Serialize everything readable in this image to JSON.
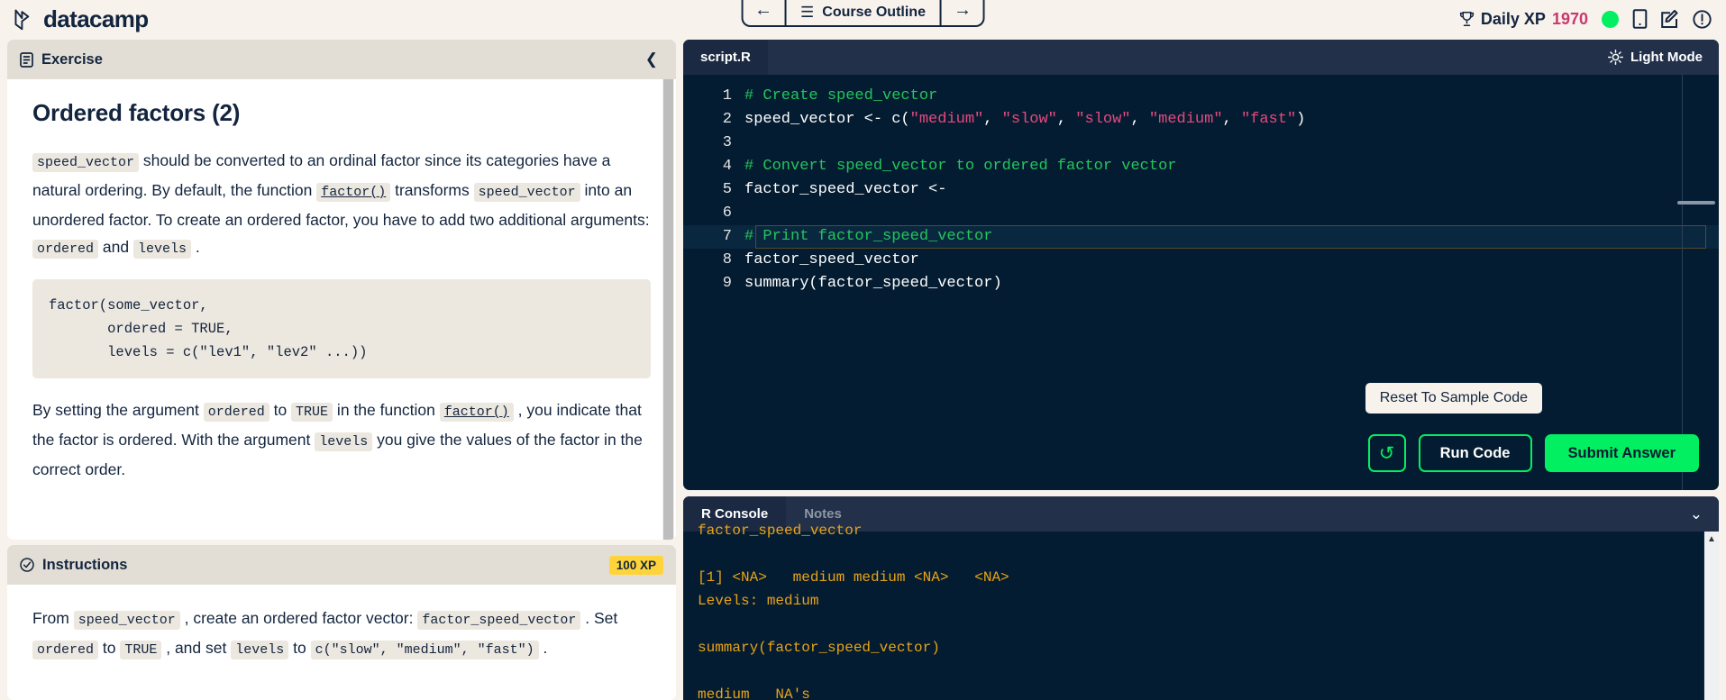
{
  "header": {
    "brand": "datacamp",
    "brand_icon": "datacamp-logo-icon",
    "back_icon": "arrow-left-icon",
    "forward_icon": "arrow-right-icon",
    "hamburger_icon": "hamburger-icon",
    "course_outline_label": "Course Outline",
    "trophy_icon": "trophy-icon",
    "daily_xp_label": "Daily XP",
    "daily_xp_value": "1970",
    "status_dot_color": "#03ef62",
    "phone_icon": "mobile-icon",
    "edit_icon": "edit-note-icon",
    "info_icon": "info-circle-icon"
  },
  "exercise": {
    "panel_icon": "document-icon",
    "panel_label": "Exercise",
    "collapse_icon": "chevron-left-icon",
    "title": "Ordered factors (2)",
    "p1": {
      "c1": "speed_vector",
      "t1": " should be converted to an ordinal factor since its categories have a natural ordering. By default, the function ",
      "c2": "factor()",
      "t2": " transforms ",
      "c3": "speed_vector",
      "t3": " into an unordered factor. To create an ordered factor, you have to add two additional arguments: ",
      "c4": "ordered",
      "t4": " and ",
      "c5": "levels",
      "t5": " ."
    },
    "code_block": "factor(some_vector,\n       ordered = TRUE,\n       levels = c(\"lev1\", \"lev2\" ...))",
    "p2": {
      "t0": "By setting the argument ",
      "c1": "ordered",
      "t1": " to ",
      "c2": "TRUE",
      "t2": " in the function ",
      "c3": "factor()",
      "t3": " , you indicate that the factor is ordered. With the argument ",
      "c4": "levels",
      "t4": " you give the values of the factor in the correct order."
    }
  },
  "instructions": {
    "panel_icon": "check-circle-icon",
    "panel_label": "Instructions",
    "xp_badge": "100 XP",
    "p1": {
      "t0": "From ",
      "c1": "speed_vector",
      "t1": " , create an ordered factor vector: ",
      "c2": "factor_speed_vector",
      "t2": " . Set ",
      "c3": "ordered",
      "t3": " to ",
      "c4": "TRUE",
      "t4": " , and set ",
      "c5": "levels",
      "t5": " to ",
      "c6": "c(\"slow\", \"medium\", \"fast\")",
      "t6": " ."
    }
  },
  "editor": {
    "file_tab": "script.R",
    "light_mode_label": "Light Mode",
    "sun_icon": "sun-icon",
    "active_line": 7,
    "lines": [
      {
        "n": "1",
        "tokens": [
          {
            "t": "# Create speed_vector",
            "k": "comment"
          }
        ]
      },
      {
        "n": "2",
        "tokens": [
          {
            "t": "speed_vector <- c(",
            "k": "plain"
          },
          {
            "t": "\"medium\"",
            "k": "string"
          },
          {
            "t": ", ",
            "k": "plain"
          },
          {
            "t": "\"slow\"",
            "k": "string"
          },
          {
            "t": ", ",
            "k": "plain"
          },
          {
            "t": "\"slow\"",
            "k": "string"
          },
          {
            "t": ", ",
            "k": "plain"
          },
          {
            "t": "\"medium\"",
            "k": "string"
          },
          {
            "t": ", ",
            "k": "plain"
          },
          {
            "t": "\"fast\"",
            "k": "string"
          },
          {
            "t": ")",
            "k": "plain"
          }
        ]
      },
      {
        "n": "3",
        "tokens": []
      },
      {
        "n": "4",
        "tokens": [
          {
            "t": "# Convert speed_vector to ordered factor vector",
            "k": "comment"
          }
        ]
      },
      {
        "n": "5",
        "tokens": [
          {
            "t": "factor_speed_vector <-",
            "k": "plain"
          }
        ]
      },
      {
        "n": "6",
        "tokens": []
      },
      {
        "n": "7",
        "tokens": [
          {
            "t": "# Print factor_speed_vector",
            "k": "comment"
          }
        ]
      },
      {
        "n": "8",
        "tokens": [
          {
            "t": "factor_speed_vector",
            "k": "plain"
          }
        ]
      },
      {
        "n": "9",
        "tokens": [
          {
            "t": "summary(factor_speed_vector)",
            "k": "plain"
          }
        ]
      }
    ],
    "tooltip": "Reset To Sample Code",
    "reset_icon": "reset-arrow-icon",
    "run_label": "Run Code",
    "submit_label": "Submit Answer"
  },
  "console": {
    "tabs": [
      {
        "label": "R Console",
        "active": true
      },
      {
        "label": "Notes",
        "active": false
      }
    ],
    "chevron_icon": "chevron-down-icon",
    "output": [
      "factor_speed_vector",
      "",
      "[1] <NA>   medium medium <NA>   <NA>",
      "Levels: medium",
      "",
      "summary(factor_speed_vector)",
      "",
      "medium   NA's"
    ]
  }
}
